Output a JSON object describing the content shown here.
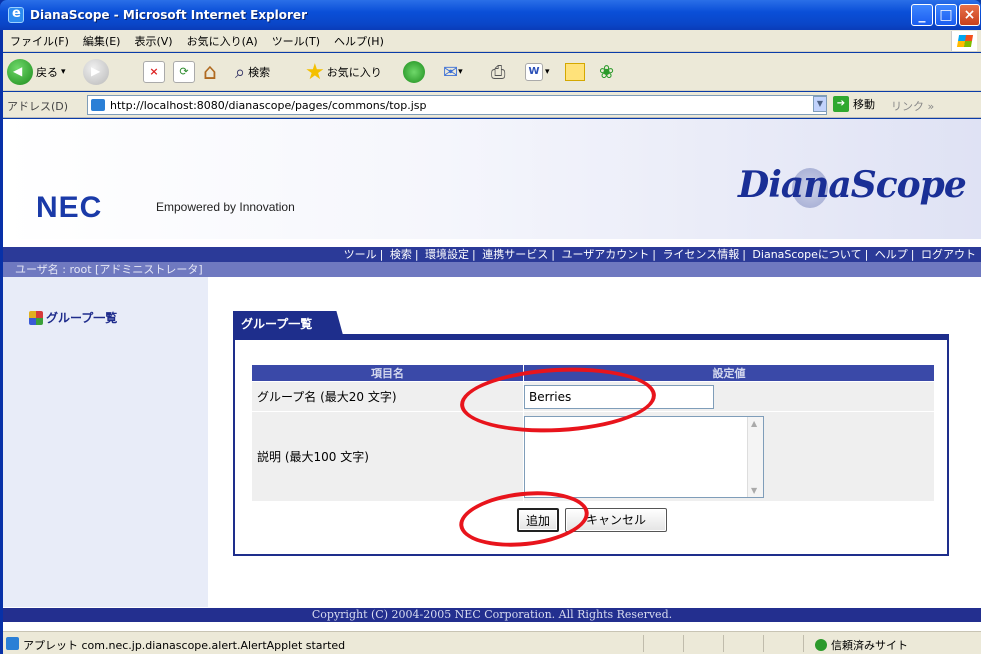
{
  "window": {
    "title": "DianaScope - Microsoft Internet Explorer",
    "min_glyph": "_",
    "max_glyph": "□",
    "close_glyph": "×"
  },
  "menu": [
    "ファイル(F)",
    "編集(E)",
    "表示(V)",
    "お気に入り(A)",
    "ツール(T)",
    "ヘルプ(H)"
  ],
  "toolbar": {
    "back_label": "戻る",
    "search_label": "検索",
    "favorites_label": "お気に入り"
  },
  "address": {
    "label": "アドレス(D)",
    "url": "http://localhost:8080/dianascope/pages/commons/top.jsp",
    "go_label": "移動",
    "links_label": "リンク »"
  },
  "header": {
    "brand": "NEC",
    "tagline": "Empowered by Innovation",
    "product_logo": "DianaScope"
  },
  "nav": [
    "ツール",
    "検索",
    "環境設定",
    "連携サービス",
    "ユーザアカウント",
    "ライセンス情報",
    "DianaScopeについて",
    "ヘルプ",
    "ログアウト"
  ],
  "user_line": "ユーザ名 : root [アドミニストレータ]",
  "sidebar": {
    "item": "グループ一覧"
  },
  "panel": {
    "tab": "グループ一覧",
    "col_item": "項目名",
    "col_value": "設定値",
    "rows": [
      {
        "label": "グループ名 (最大20 文字)",
        "value": "Berries"
      },
      {
        "label": "説明 (最大100 文字)",
        "value": ""
      }
    ],
    "add_button": "追加",
    "cancel_button": "キャンセル"
  },
  "footer": "Copyright (C) 2004-2005 NEC Corporation. All Rights Reserved.",
  "status": {
    "message": "アプレット com.nec.jp.dianascope.alert.AlertApplet started",
    "zone": "信頼済みサイト"
  },
  "colors": {
    "navy": "#1e2e8c",
    "highlight_ellipse": "#e8141c"
  }
}
